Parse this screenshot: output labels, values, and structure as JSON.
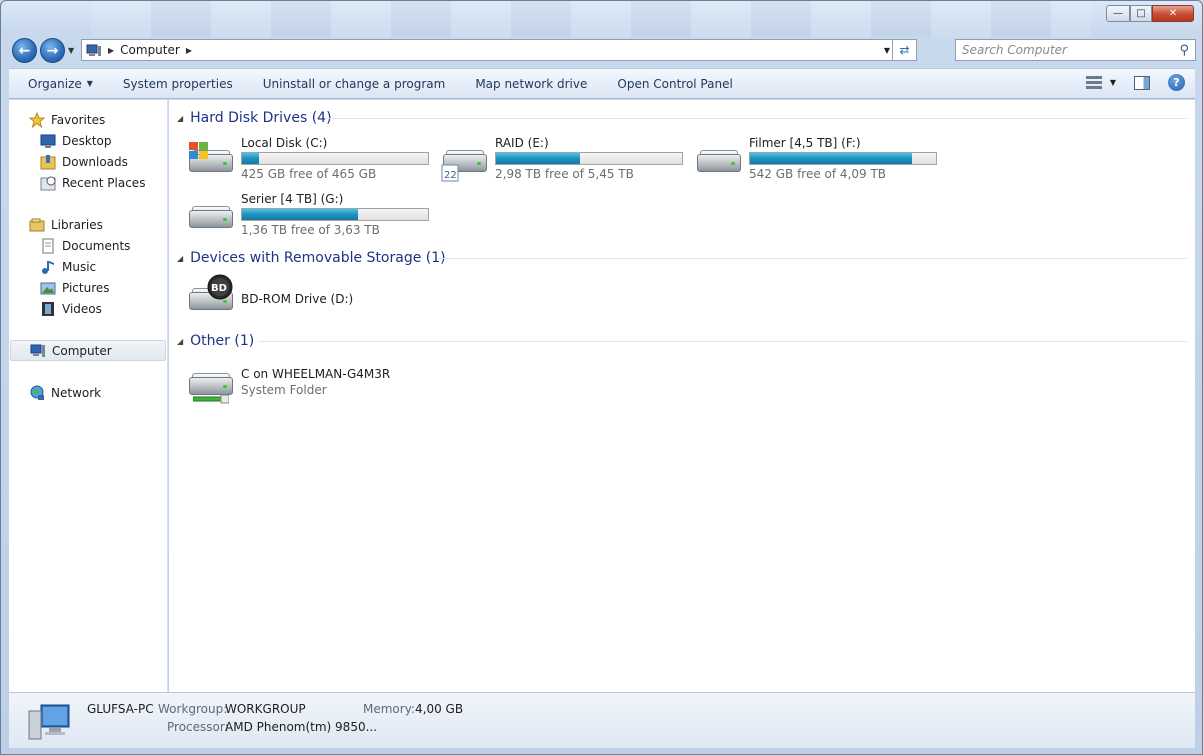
{
  "window": {
    "title": "Computer"
  },
  "address": {
    "crumb": "Computer"
  },
  "search": {
    "placeholder": "Search Computer"
  },
  "commands": {
    "organize": "Organize",
    "system_properties": "System properties",
    "uninstall": "Uninstall or change a program",
    "map_drive": "Map network drive",
    "control_panel": "Open Control Panel"
  },
  "sidebar": {
    "favorites": "Favorites",
    "desktop": "Desktop",
    "downloads": "Downloads",
    "recent": "Recent Places",
    "libraries": "Libraries",
    "documents": "Documents",
    "music": "Music",
    "pictures": "Pictures",
    "videos": "Videos",
    "computer": "Computer",
    "network": "Network"
  },
  "groups": {
    "hdd": "Hard Disk Drives (4)",
    "removable": "Devices with Removable Storage (1)",
    "other": "Other (1)"
  },
  "drives": [
    {
      "name": "Local Disk (C:)",
      "free": "425 GB free of 465 GB",
      "used_fraction": 0.09
    },
    {
      "name": "RAID (E:)",
      "free": "2,98 TB free of 5,45 TB",
      "used_fraction": 0.45
    },
    {
      "name": "Filmer [4,5 TB] (F:)",
      "free": "542 GB free of 4,09 TB",
      "used_fraction": 0.87
    },
    {
      "name": "Serier [4 TB] (G:)",
      "free": "1,36 TB free of 3,63 TB",
      "used_fraction": 0.625
    }
  ],
  "removable": {
    "name": "BD-ROM Drive (D:)",
    "badge": "BD"
  },
  "other": {
    "name": "C on WHEELMAN-G4M3R",
    "sub": "System Folder"
  },
  "status": {
    "pc_name": "GLUFSA-PC",
    "workgroup_label": "Workgroup:",
    "workgroup": "WORKGROUP",
    "memory_label": "Memory:",
    "memory": "4,00 GB",
    "processor_label": "Processor:",
    "processor": "AMD Phenom(tm) 9850..."
  },
  "colors": {
    "accent": "#1e3287",
    "bar_fill": "#1d92bf",
    "selection": "#e2e8ef"
  }
}
